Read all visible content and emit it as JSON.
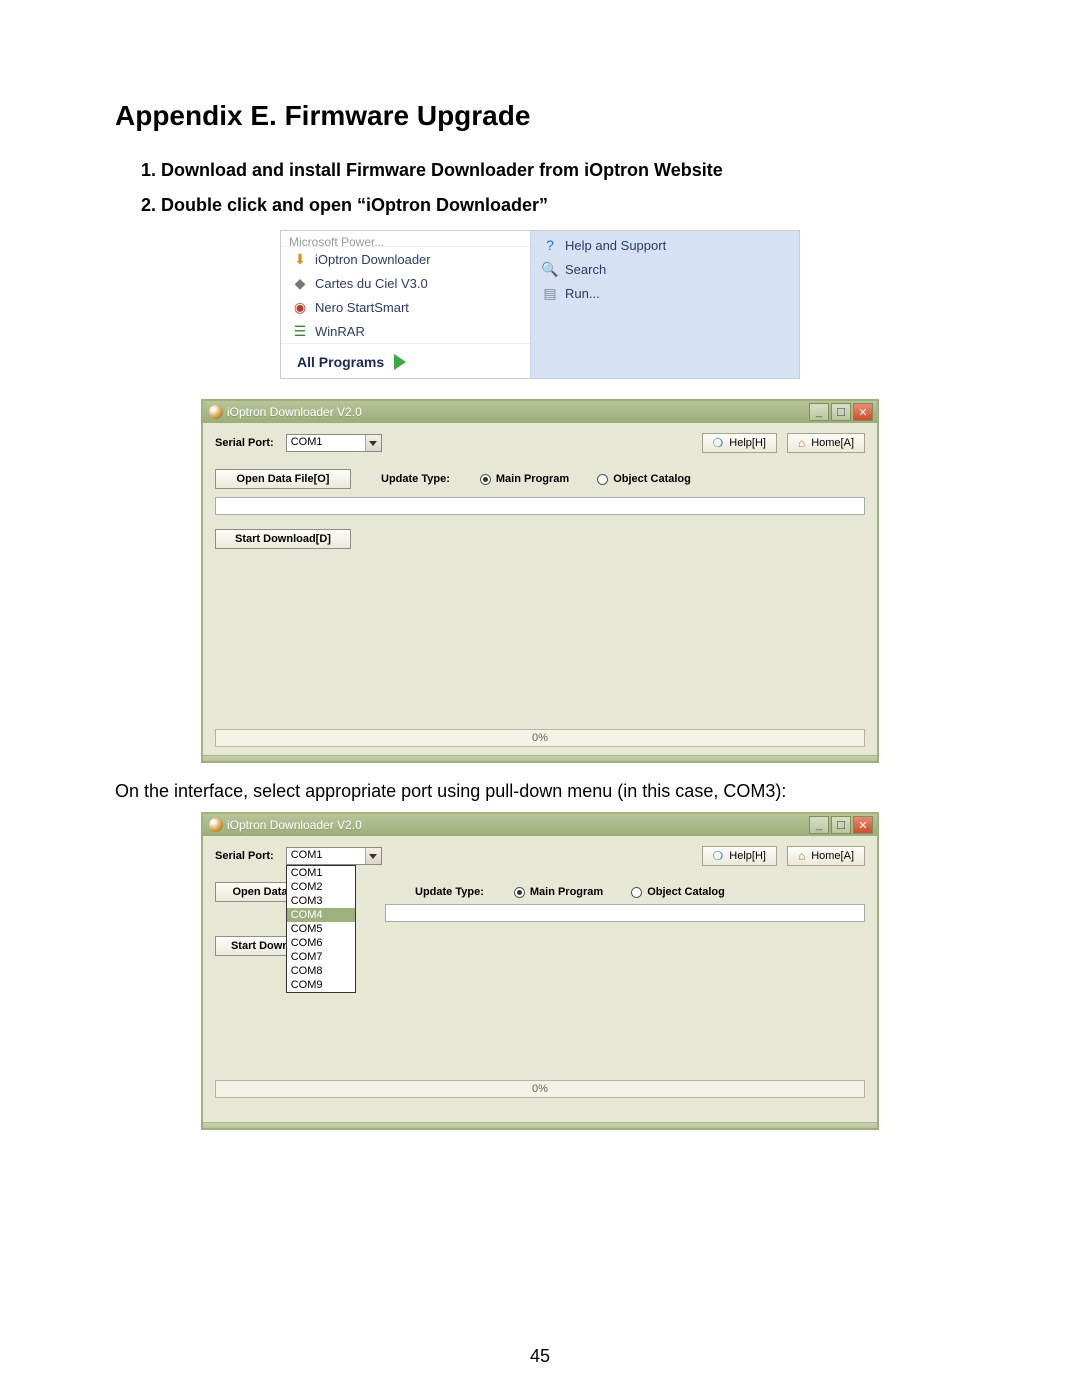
{
  "heading": "Appendix E. Firmware Upgrade",
  "steps": {
    "s1": "1.   Download and install Firmware Downloader from iOptron Website",
    "s2": "2.   Double click and open “iOptron Downloader”"
  },
  "startmenu": {
    "truncated_top": "Microsoft Power...",
    "left": [
      {
        "icon": "⬇",
        "iconClass": "ico-orange",
        "label": "iOptron Downloader"
      },
      {
        "icon": "◆",
        "iconClass": "ico-gray",
        "label": "Cartes du Ciel V3.0"
      },
      {
        "icon": "◉",
        "iconClass": "ico-red",
        "label": "Nero StartSmart"
      },
      {
        "icon": "☰",
        "iconClass": "ico-multi",
        "label": "WinRAR"
      }
    ],
    "all_programs": "All Programs",
    "right": [
      {
        "icon": "?",
        "iconClass": "ico-blue",
        "label": "Help and Support"
      },
      {
        "icon": "🔍",
        "iconClass": "ico-search",
        "label": "Search"
      },
      {
        "icon": "▤",
        "iconClass": "ico-run",
        "label": "Run..."
      }
    ]
  },
  "app": {
    "title": "iOptron Downloader V2.0",
    "serial_port_label": "Serial Port:",
    "serial_value": "COM1",
    "help_btn": "Help[H]",
    "home_btn": "Home[A]",
    "open_btn": "Open Data File[O]",
    "update_type_label": "Update Type:",
    "radio_main": "Main Program",
    "radio_catalog": "Object Catalog",
    "start_btn": "Start Download[D]",
    "progress": "0%"
  },
  "body_text": "On the interface, select appropriate port using pull-down menu (in this case, COM3):",
  "app2": {
    "open_btn_short": "Open Data",
    "start_btn_short": "Start Down",
    "com_options": [
      "COM1",
      "COM2",
      "COM3",
      "COM4",
      "COM5",
      "COM6",
      "COM7",
      "COM8",
      "COM9"
    ],
    "com_selected_index": 3
  },
  "page_number": "45"
}
